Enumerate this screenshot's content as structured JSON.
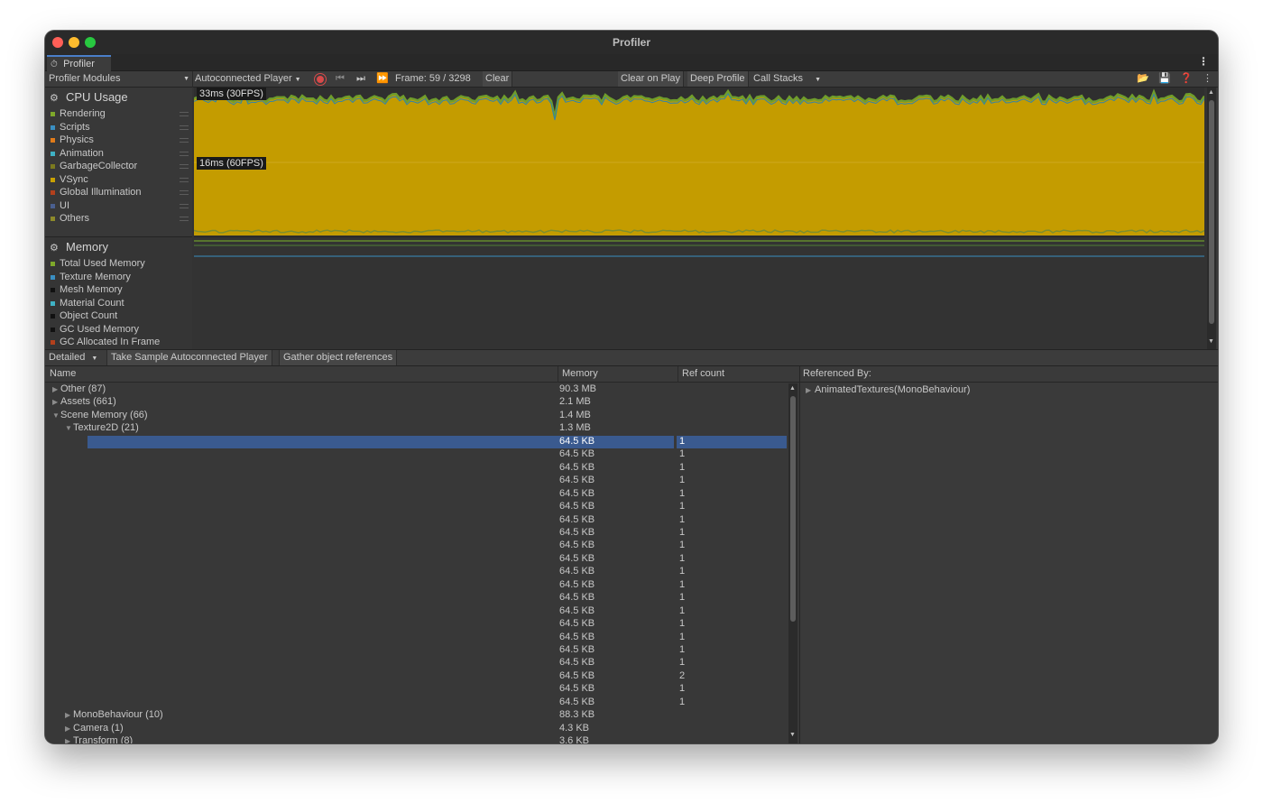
{
  "window": {
    "title": "Profiler"
  },
  "tab": {
    "label": "Profiler",
    "icon": "profiler-icon"
  },
  "toolbar": {
    "modules_dropdown": "Profiler Modules",
    "player_dropdown": "Autoconnected Player",
    "frame_label": "Frame: 59 / 3298",
    "clear": "Clear",
    "clear_on_play": "Clear on Play",
    "deep_profile": "Deep Profile",
    "call_stacks": "Call Stacks"
  },
  "cpu_module": {
    "title": "CPU Usage",
    "legend": [
      {
        "label": "Rendering",
        "color": "#7ea82a"
      },
      {
        "label": "Scripts",
        "color": "#3a8fc2"
      },
      {
        "label": "Physics",
        "color": "#e07b1a"
      },
      {
        "label": "Animation",
        "color": "#3fb1c4"
      },
      {
        "label": "GarbageCollector",
        "color": "#7b7a1f"
      },
      {
        "label": "VSync",
        "color": "#c9a100"
      },
      {
        "label": "Global Illumination",
        "color": "#b3401c"
      },
      {
        "label": "UI",
        "color": "#4a5f8f"
      },
      {
        "label": "Others",
        "color": "#8d8a2a"
      }
    ],
    "label_30fps": "33ms (30FPS)",
    "label_60fps": "16ms (60FPS)"
  },
  "memory_module": {
    "title": "Memory",
    "legend": [
      {
        "label": "Total Used Memory",
        "color": "#7ea82a"
      },
      {
        "label": "Texture Memory",
        "color": "#3a8fc2"
      },
      {
        "label": "Mesh Memory",
        "color": "#111111"
      },
      {
        "label": "Material Count",
        "color": "#3fb1c4"
      },
      {
        "label": "Object Count",
        "color": "#111111"
      },
      {
        "label": "GC Used Memory",
        "color": "#111111"
      },
      {
        "label": "GC Allocated In Frame",
        "color": "#b3401c"
      }
    ]
  },
  "details": {
    "view_dropdown": "Detailed",
    "take_sample": "Take Sample Autoconnected Player",
    "gather_refs": "Gather object references",
    "columns": {
      "name": "Name",
      "memory": "Memory",
      "ref_count": "Ref count"
    },
    "rows": [
      {
        "name": "Other (87)",
        "memory": "90.3 MB",
        "ref": "",
        "indent": 0,
        "tri": "right",
        "selected": false
      },
      {
        "name": "Assets (661)",
        "memory": "2.1 MB",
        "ref": "",
        "indent": 0,
        "tri": "right",
        "selected": false
      },
      {
        "name": "Scene Memory (66)",
        "memory": "1.4 MB",
        "ref": "",
        "indent": 0,
        "tri": "down",
        "selected": false
      },
      {
        "name": "Texture2D (21)",
        "memory": "1.3 MB",
        "ref": "",
        "indent": 1,
        "tri": "down",
        "selected": false
      },
      {
        "name": "",
        "memory": "64.5 KB",
        "ref": "1",
        "indent": 2,
        "tri": "",
        "selected": true
      },
      {
        "name": "",
        "memory": "64.5 KB",
        "ref": "1",
        "indent": 2,
        "tri": "",
        "selected": false
      },
      {
        "name": "",
        "memory": "64.5 KB",
        "ref": "1",
        "indent": 2,
        "tri": "",
        "selected": false
      },
      {
        "name": "",
        "memory": "64.5 KB",
        "ref": "1",
        "indent": 2,
        "tri": "",
        "selected": false
      },
      {
        "name": "",
        "memory": "64.5 KB",
        "ref": "1",
        "indent": 2,
        "tri": "",
        "selected": false
      },
      {
        "name": "",
        "memory": "64.5 KB",
        "ref": "1",
        "indent": 2,
        "tri": "",
        "selected": false
      },
      {
        "name": "",
        "memory": "64.5 KB",
        "ref": "1",
        "indent": 2,
        "tri": "",
        "selected": false
      },
      {
        "name": "",
        "memory": "64.5 KB",
        "ref": "1",
        "indent": 2,
        "tri": "",
        "selected": false
      },
      {
        "name": "",
        "memory": "64.5 KB",
        "ref": "1",
        "indent": 2,
        "tri": "",
        "selected": false
      },
      {
        "name": "",
        "memory": "64.5 KB",
        "ref": "1",
        "indent": 2,
        "tri": "",
        "selected": false
      },
      {
        "name": "",
        "memory": "64.5 KB",
        "ref": "1",
        "indent": 2,
        "tri": "",
        "selected": false
      },
      {
        "name": "",
        "memory": "64.5 KB",
        "ref": "1",
        "indent": 2,
        "tri": "",
        "selected": false
      },
      {
        "name": "",
        "memory": "64.5 KB",
        "ref": "1",
        "indent": 2,
        "tri": "",
        "selected": false
      },
      {
        "name": "",
        "memory": "64.5 KB",
        "ref": "1",
        "indent": 2,
        "tri": "",
        "selected": false
      },
      {
        "name": "",
        "memory": "64.5 KB",
        "ref": "1",
        "indent": 2,
        "tri": "",
        "selected": false
      },
      {
        "name": "",
        "memory": "64.5 KB",
        "ref": "1",
        "indent": 2,
        "tri": "",
        "selected": false
      },
      {
        "name": "",
        "memory": "64.5 KB",
        "ref": "1",
        "indent": 2,
        "tri": "",
        "selected": false
      },
      {
        "name": "",
        "memory": "64.5 KB",
        "ref": "1",
        "indent": 2,
        "tri": "",
        "selected": false
      },
      {
        "name": "",
        "memory": "64.5 KB",
        "ref": "2",
        "indent": 2,
        "tri": "",
        "selected": false
      },
      {
        "name": "",
        "memory": "64.5 KB",
        "ref": "1",
        "indent": 2,
        "tri": "",
        "selected": false
      },
      {
        "name": "",
        "memory": "64.5 KB",
        "ref": "1",
        "indent": 2,
        "tri": "",
        "selected": false
      },
      {
        "name": "MonoBehaviour (10)",
        "memory": "88.3 KB",
        "ref": "",
        "indent": 1,
        "tri": "right",
        "selected": false
      },
      {
        "name": "Camera (1)",
        "memory": "4.3 KB",
        "ref": "",
        "indent": 1,
        "tri": "right",
        "selected": false
      },
      {
        "name": "Transform (8)",
        "memory": "3.6 KB",
        "ref": "",
        "indent": 1,
        "tri": "right",
        "selected": false
      }
    ],
    "referenced_by": {
      "title": "Referenced By:",
      "items": [
        "AnimatedTextures(MonoBehaviour)"
      ]
    }
  }
}
